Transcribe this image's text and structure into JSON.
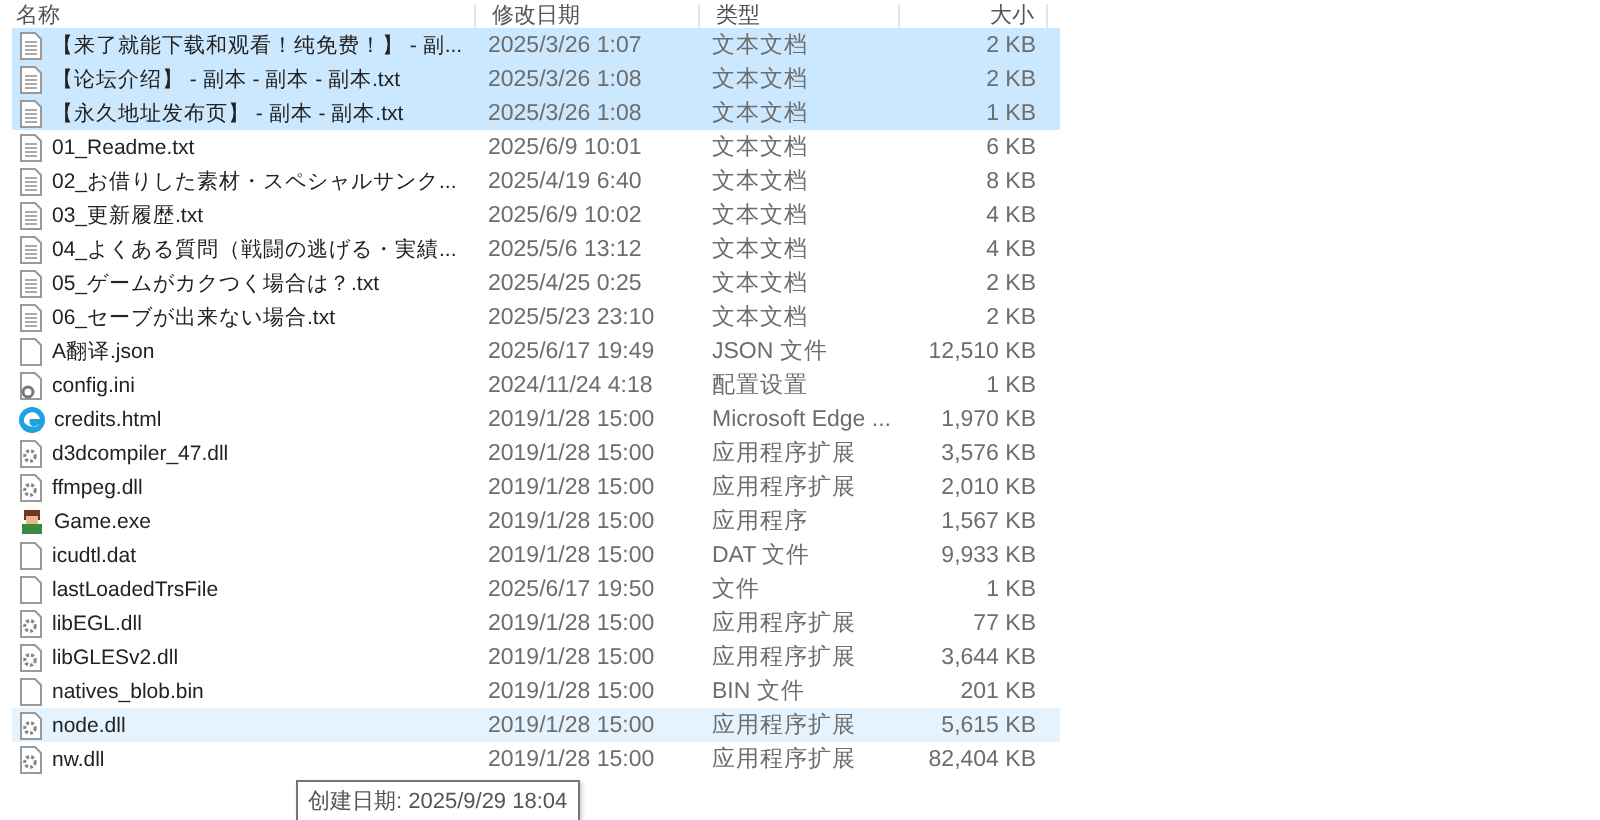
{
  "columns": [
    "名称",
    "修改日期",
    "类型",
    "大小"
  ],
  "rows": [
    {
      "kind": "text",
      "name": "【来了就能下载和观看！纯免费！】 - 副...",
      "date": "2025/3/26 1:07",
      "type": "文本文档",
      "size": "2 KB",
      "selected": true,
      "hovered": false
    },
    {
      "kind": "text",
      "name": "【论坛介绍】 - 副本 - 副本 - 副本.txt",
      "date": "2025/3/26 1:08",
      "type": "文本文档",
      "size": "2 KB",
      "selected": true,
      "hovered": false
    },
    {
      "kind": "text",
      "name": "【永久地址发布页】 - 副本 - 副本.txt",
      "date": "2025/3/26 1:08",
      "type": "文本文档",
      "size": "1 KB",
      "selected": true,
      "hovered": false
    },
    {
      "kind": "text",
      "name": "01_Readme.txt",
      "date": "2025/6/9 10:01",
      "type": "文本文档",
      "size": "6 KB",
      "selected": false,
      "hovered": false
    },
    {
      "kind": "text",
      "name": "02_お借りした素材・スペシャルサンク...",
      "date": "2025/4/19 6:40",
      "type": "文本文档",
      "size": "8 KB",
      "selected": false,
      "hovered": false
    },
    {
      "kind": "text",
      "name": "03_更新履歴.txt",
      "date": "2025/6/9 10:02",
      "type": "文本文档",
      "size": "4 KB",
      "selected": false,
      "hovered": false
    },
    {
      "kind": "text",
      "name": "04_よくある質問（戦闘の逃げる・実績...",
      "date": "2025/5/6 13:12",
      "type": "文本文档",
      "size": "4 KB",
      "selected": false,
      "hovered": false
    },
    {
      "kind": "text",
      "name": "05_ゲームがカクつく場合は？.txt",
      "date": "2025/4/25 0:25",
      "type": "文本文档",
      "size": "2 KB",
      "selected": false,
      "hovered": false
    },
    {
      "kind": "text",
      "name": "06_セーブが出来ない場合.txt",
      "date": "2025/5/23 23:10",
      "type": "文本文档",
      "size": "2 KB",
      "selected": false,
      "hovered": false
    },
    {
      "kind": "blank",
      "name": "A翻译.json",
      "date": "2025/6/17 19:49",
      "type": "JSON 文件",
      "size": "12,510 KB",
      "selected": false,
      "hovered": false
    },
    {
      "kind": "settings",
      "name": "config.ini",
      "date": "2024/11/24 4:18",
      "type": "配置设置",
      "size": "1 KB",
      "selected": false,
      "hovered": false
    },
    {
      "kind": "edge",
      "name": "credits.html",
      "date": "2019/1/28 15:00",
      "type": "Microsoft Edge ...",
      "size": "1,970 KB",
      "selected": false,
      "hovered": false
    },
    {
      "kind": "dll",
      "name": "d3dcompiler_47.dll",
      "date": "2019/1/28 15:00",
      "type": "应用程序扩展",
      "size": "3,576 KB",
      "selected": false,
      "hovered": false
    },
    {
      "kind": "dll",
      "name": "ffmpeg.dll",
      "date": "2019/1/28 15:00",
      "type": "应用程序扩展",
      "size": "2,010 KB",
      "selected": false,
      "hovered": false
    },
    {
      "kind": "app",
      "name": "Game.exe",
      "date": "2019/1/28 15:00",
      "type": "应用程序",
      "size": "1,567 KB",
      "selected": false,
      "hovered": false
    },
    {
      "kind": "blank",
      "name": "icudtl.dat",
      "date": "2019/1/28 15:00",
      "type": "DAT 文件",
      "size": "9,933 KB",
      "selected": false,
      "hovered": false
    },
    {
      "kind": "blank",
      "name": "lastLoadedTrsFile",
      "date": "2025/6/17 19:50",
      "type": "文件",
      "size": "1 KB",
      "selected": false,
      "hovered": false
    },
    {
      "kind": "dll",
      "name": "libEGL.dll",
      "date": "2019/1/28 15:00",
      "type": "应用程序扩展",
      "size": "77 KB",
      "selected": false,
      "hovered": false
    },
    {
      "kind": "dll",
      "name": "libGLESv2.dll",
      "date": "2019/1/28 15:00",
      "type": "应用程序扩展",
      "size": "3,644 KB",
      "selected": false,
      "hovered": false
    },
    {
      "kind": "blank",
      "name": "natives_blob.bin",
      "date": "2019/1/28 15:00",
      "type": "BIN 文件",
      "size": "201 KB",
      "selected": false,
      "hovered": false
    },
    {
      "kind": "dll",
      "name": "node.dll",
      "date": "2019/1/28 15:00",
      "type": "应用程序扩展",
      "size": "5,615 KB",
      "selected": false,
      "hovered": true
    },
    {
      "kind": "dll",
      "name": "nw.dll",
      "date": "2019/1/28 15:00",
      "type": "应用程序扩展",
      "size": "82,404 KB",
      "selected": false,
      "hovered": false
    }
  ],
  "tooltip": "创建日期: 2025/9/29 18:04"
}
